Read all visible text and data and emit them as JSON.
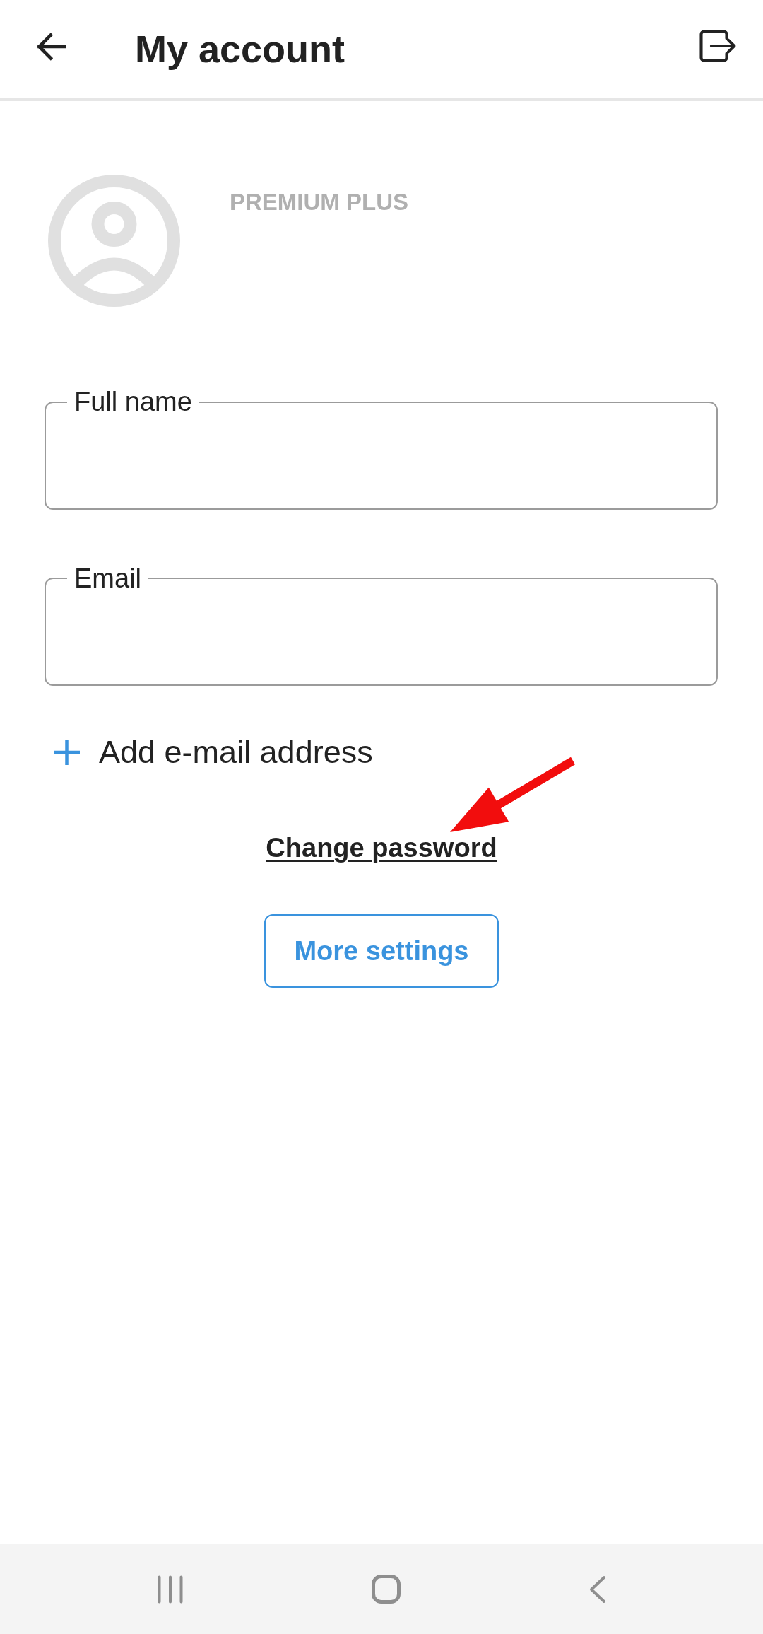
{
  "header": {
    "title": "My account"
  },
  "profile": {
    "plan": "PREMIUM PLUS"
  },
  "fields": [
    {
      "label": "Full name"
    },
    {
      "label": "Email"
    }
  ],
  "add_email": {
    "label": "Add e-mail address"
  },
  "change_password": {
    "label": "Change password"
  },
  "more_settings": {
    "label": "More settings"
  }
}
